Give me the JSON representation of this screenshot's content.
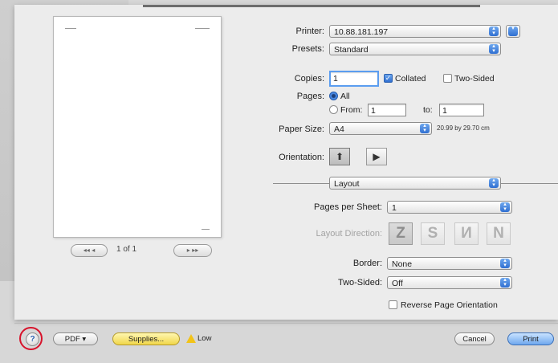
{
  "preview": {
    "page_indicator": "1 of 1",
    "first_btn": "◂◂ ◂",
    "last_btn": "▸ ▸▸"
  },
  "printer": {
    "label": "Printer:",
    "value": "10.88.181.197"
  },
  "presets": {
    "label": "Presets:",
    "value": "Standard"
  },
  "copies": {
    "label": "Copies:",
    "value": "1",
    "collated_label": "Collated",
    "collated_checked": true,
    "two_sided_label": "Two-Sided",
    "two_sided_checked": false
  },
  "pages": {
    "label": "Pages:",
    "all_label": "All",
    "from_label": "From:",
    "from_value": "1",
    "to_label": "to:",
    "to_value": "1",
    "selected": "All"
  },
  "paper_size": {
    "label": "Paper Size:",
    "value": "A4",
    "dimensions": "20.99 by 29.70 cm"
  },
  "orientation": {
    "label": "Orientation:",
    "selected": "portrait"
  },
  "section": {
    "value": "Layout"
  },
  "layout": {
    "pages_per_sheet_label": "Pages per Sheet:",
    "pages_per_sheet_value": "1",
    "direction_label": "Layout Direction:",
    "directions": [
      "Z",
      "S",
      "И",
      "N"
    ],
    "border_label": "Border:",
    "border_value": "None",
    "two_sided_label": "Two-Sided:",
    "two_sided_value": "Off",
    "reverse_label": "Reverse Page Orientation",
    "reverse_checked": false
  },
  "bottom": {
    "help": "?",
    "pdf": "PDF ▾",
    "supplies": "Supplies...",
    "low": "Low",
    "cancel": "Cancel",
    "print": "Print"
  },
  "colors": {
    "accent": "#2f6fd1",
    "highlight_ring": "#d7132b",
    "warning": "#f2c318"
  }
}
